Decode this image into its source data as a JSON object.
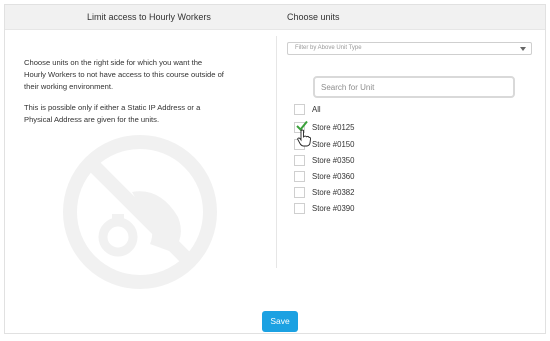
{
  "header": {
    "left_title": "Limit access to Hourly Workers",
    "right_title": "Choose units"
  },
  "description": {
    "paragraph1": "Choose units on the right side for which you want the Hourly Workers to not have access to this course outside of their working environment.",
    "paragraph2": "This is possible only if either a Static IP Address or a Physical Address are given for the units."
  },
  "filter": {
    "selected": "Filter by Above Unit Type"
  },
  "search": {
    "placeholder": "Search for Unit",
    "value": ""
  },
  "units": [
    {
      "label": "All",
      "checked": false
    },
    {
      "label": "Store #0125",
      "checked": true
    },
    {
      "label": "Store #0150",
      "checked": false
    },
    {
      "label": "Store #0350",
      "checked": false
    },
    {
      "label": "Store #0360",
      "checked": false
    },
    {
      "label": "Store #0382",
      "checked": false
    },
    {
      "label": "Store #0390",
      "checked": false
    }
  ],
  "actions": {
    "save_label": "Save"
  },
  "colors": {
    "accent": "#1ba1e2",
    "checkmark": "#3aa13a"
  }
}
